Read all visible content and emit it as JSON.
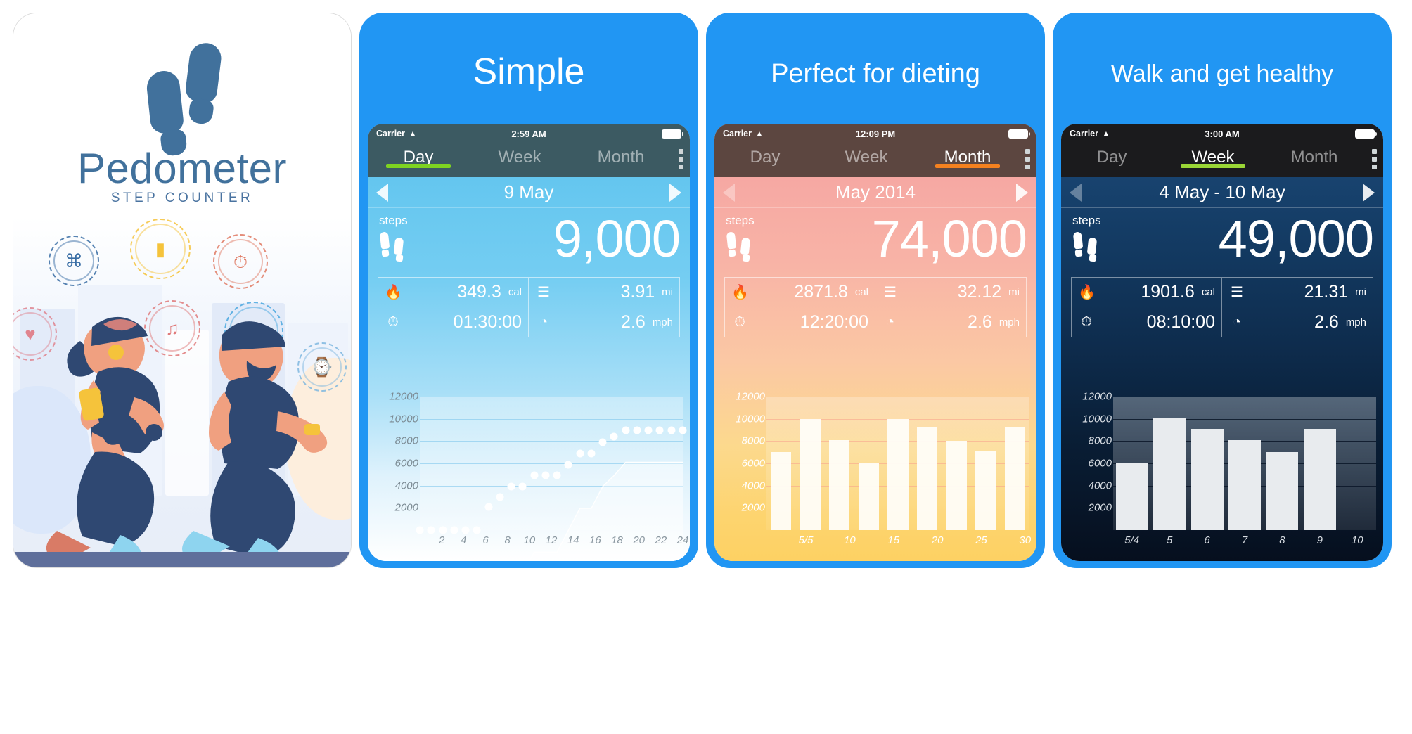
{
  "gallery": {
    "panels": [
      {
        "kind": "hero",
        "brand_title": "Pedometer",
        "brand_subtitle": "STEP COUNTER",
        "badges": [
          {
            "name": "location-pin-icon",
            "glyph": "⌘",
            "color": "#3a6ea5"
          },
          {
            "name": "water-bottle-icon",
            "glyph": "▮",
            "color": "#f5c33b"
          },
          {
            "name": "stopwatch-icon",
            "glyph": "⏱",
            "color": "#e07a63"
          },
          {
            "name": "heart-rate-icon",
            "glyph": "♥",
            "color": "#e0848f"
          },
          {
            "name": "music-note-icon",
            "glyph": "♫",
            "color": "#e07a7a"
          },
          {
            "name": "running-shoe-icon",
            "glyph": "◢",
            "color": "#4aa8e0"
          },
          {
            "name": "smartwatch-icon",
            "glyph": "⌚",
            "color": "#7fb8e0"
          }
        ]
      },
      {
        "kind": "phone",
        "theme": "t-blue",
        "headline": "Simple",
        "headline_class": "h-simple",
        "statusbar": {
          "carrier": "Carrier",
          "wifi_icon": "wifi-icon",
          "time": "2:59 AM",
          "battery_icon": "battery-icon"
        },
        "tabs": [
          {
            "label": "Day",
            "active": true
          },
          {
            "label": "Week",
            "active": false
          },
          {
            "label": "Month",
            "active": false
          }
        ],
        "menu_icon": "kebab-menu-icon",
        "date": {
          "label": "9 May",
          "prev_icon": "left-arrow-icon",
          "next_icon": "right-arrow-icon",
          "prev_dim": false,
          "next_dim": false
        },
        "steps": {
          "label": "steps",
          "value": "9,000",
          "feet_icon": "footprints-icon"
        },
        "metrics": [
          {
            "icon": "flame-icon",
            "glyph": "🔥",
            "value": "349.3",
            "unit": "cal"
          },
          {
            "icon": "ruler-icon",
            "glyph": "☰",
            "value": "3.91",
            "unit": "mi"
          },
          {
            "icon": "stopwatch-icon",
            "glyph": "⏱",
            "value": "01:30:00",
            "unit": ""
          },
          {
            "icon": "speedometer-icon",
            "glyph": "◔",
            "value": "2.6",
            "unit": "mph"
          }
        ]
      },
      {
        "kind": "phone",
        "theme": "t-warm",
        "headline": "Perfect for dieting",
        "headline_class": "h-diet",
        "statusbar": {
          "carrier": "Carrier",
          "wifi_icon": "wifi-icon",
          "time": "12:09 PM",
          "battery_icon": "battery-icon"
        },
        "tabs": [
          {
            "label": "Day",
            "active": false
          },
          {
            "label": "Week",
            "active": false
          },
          {
            "label": "Month",
            "active": true
          }
        ],
        "menu_icon": "kebab-menu-icon",
        "date": {
          "label": "May 2014",
          "prev_icon": "left-arrow-icon",
          "next_icon": "right-arrow-icon",
          "prev_dim": true,
          "next_dim": false
        },
        "steps": {
          "label": "steps",
          "value": "74,000",
          "feet_icon": "footprints-icon"
        },
        "metrics": [
          {
            "icon": "flame-icon",
            "glyph": "🔥",
            "value": "2871.8",
            "unit": "cal"
          },
          {
            "icon": "ruler-icon",
            "glyph": "☰",
            "value": "32.12",
            "unit": "mi"
          },
          {
            "icon": "stopwatch-icon",
            "glyph": "⏱",
            "value": "12:20:00",
            "unit": ""
          },
          {
            "icon": "speedometer-icon",
            "glyph": "◔",
            "value": "2.6",
            "unit": "mph"
          }
        ]
      },
      {
        "kind": "phone",
        "theme": "t-dark",
        "headline": "Walk and get healthy",
        "headline_class": "h-walk",
        "statusbar": {
          "carrier": "Carrier",
          "wifi_icon": "wifi-icon",
          "time": "3:00 AM",
          "battery_icon": "battery-icon"
        },
        "tabs": [
          {
            "label": "Day",
            "active": false
          },
          {
            "label": "Week",
            "active": true
          },
          {
            "label": "Month",
            "active": false
          }
        ],
        "menu_icon": "kebab-menu-icon",
        "date": {
          "label": "4 May - 10 May",
          "prev_icon": "left-arrow-icon",
          "next_icon": "right-arrow-icon",
          "prev_dim": true,
          "next_dim": false
        },
        "steps": {
          "label": "steps",
          "value": "49,000",
          "feet_icon": "footprints-icon"
        },
        "metrics": [
          {
            "icon": "flame-icon",
            "glyph": "🔥",
            "value": "1901.6",
            "unit": "cal"
          },
          {
            "icon": "ruler-icon",
            "glyph": "☰",
            "value": "21.31",
            "unit": "mi"
          },
          {
            "icon": "stopwatch-icon",
            "glyph": "⏱",
            "value": "08:10:00",
            "unit": ""
          },
          {
            "icon": "speedometer-icon",
            "glyph": "◔",
            "value": "2.6",
            "unit": "mph"
          }
        ]
      }
    ]
  },
  "chart_data": [
    {
      "panel": "Simple",
      "type": "line",
      "title": "Cumulative steps, 9 May",
      "xlabel": "",
      "ylabel": "steps",
      "ylim": [
        0,
        12000
      ],
      "yticks": [
        2000,
        4000,
        6000,
        8000,
        10000,
        12000
      ],
      "xlim": [
        0,
        24
      ],
      "xticks": [
        2,
        4,
        6,
        8,
        10,
        12,
        14,
        16,
        18,
        20,
        22,
        24
      ],
      "grid": true,
      "legend": "none",
      "x": [
        1,
        2,
        3,
        4,
        5,
        6,
        7,
        8,
        9,
        10,
        11,
        12,
        13,
        14,
        15,
        16,
        17,
        18,
        19,
        20,
        21,
        22,
        23,
        24
      ],
      "values": [
        0,
        0,
        0,
        0,
        0,
        0,
        2100,
        3000,
        3900,
        3900,
        4900,
        4900,
        4900,
        5900,
        6900,
        6900,
        7900,
        8400,
        9000,
        9000,
        9000,
        9000,
        9000,
        9000
      ]
    },
    {
      "panel": "Perfect for dieting",
      "type": "bar",
      "title": "Daily steps, May 2014",
      "xlabel": "",
      "ylabel": "steps",
      "ylim": [
        0,
        12000
      ],
      "yticks": [
        2000,
        4000,
        6000,
        8000,
        10000,
        12000
      ],
      "xticks": [
        "5/5",
        "10",
        "15",
        "20",
        "25",
        "30"
      ],
      "grid": true,
      "legend": "none",
      "categories": [
        "1",
        "2",
        "3",
        "4",
        "5",
        "6",
        "7",
        "8",
        "9"
      ],
      "values": [
        7000,
        10000,
        8100,
        6000,
        10000,
        9200,
        8000,
        7100,
        9200
      ]
    },
    {
      "panel": "Walk and get healthy",
      "type": "bar",
      "title": "Daily steps, 4 May - 10 May",
      "xlabel": "",
      "ylabel": "steps",
      "ylim": [
        0,
        12000
      ],
      "yticks": [
        2000,
        4000,
        6000,
        8000,
        10000,
        12000
      ],
      "grid": true,
      "legend": "none",
      "categories": [
        "5/4",
        "5",
        "6",
        "7",
        "8",
        "9",
        "10"
      ],
      "values": [
        6000,
        10100,
        9100,
        8100,
        7000,
        9100,
        0
      ]
    }
  ]
}
